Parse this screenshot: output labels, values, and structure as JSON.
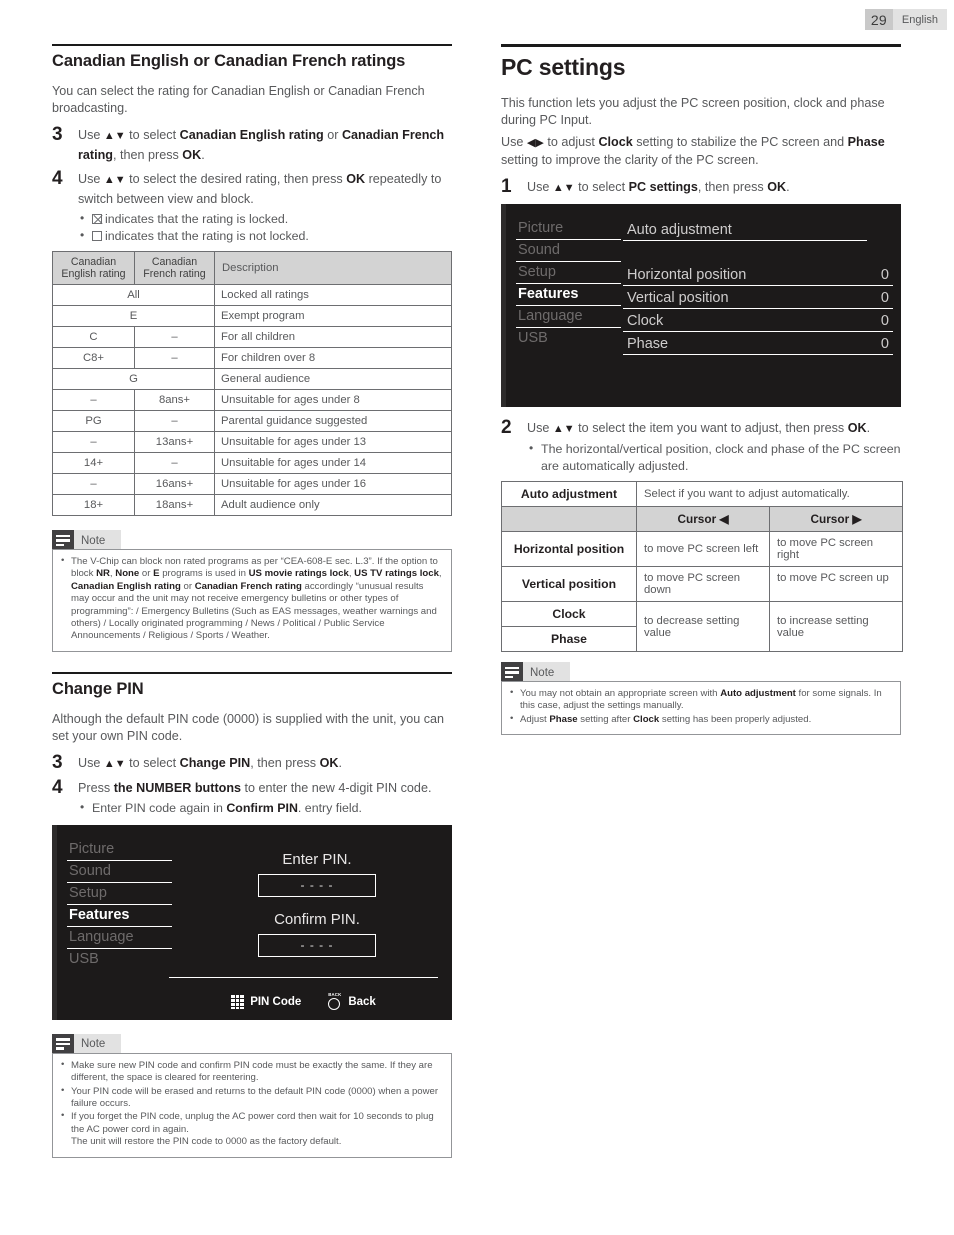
{
  "header": {
    "page_number": "29",
    "language": "English"
  },
  "left": {
    "section1_title": "Canadian English or Canadian French ratings",
    "intro": "You can select the rating for Canadian English or Canadian French broadcasting.",
    "step3_num": "3",
    "step4_num": "4",
    "bullet_locked": "indicates that the rating is locked.",
    "bullet_unlocked": "indicates that the rating is not locked.",
    "ratings_table": {
      "headers": [
        "Canadian English rating",
        "Canadian French rating",
        "Description"
      ],
      "rows": [
        {
          "span": true,
          "eng": "All",
          "fre": "",
          "desc": "Locked all ratings"
        },
        {
          "span": true,
          "eng": "E",
          "fre": "",
          "desc": "Exempt program"
        },
        {
          "span": false,
          "eng": "C",
          "fre": "–",
          "desc": "For all children"
        },
        {
          "span": false,
          "eng": "C8+",
          "fre": "–",
          "desc": "For children over 8"
        },
        {
          "span": true,
          "eng": "G",
          "fre": "",
          "desc": "General audience"
        },
        {
          "span": false,
          "eng": "–",
          "fre": "8ans+",
          "desc": "Unsuitable for ages under 8"
        },
        {
          "span": false,
          "eng": "PG",
          "fre": "–",
          "desc": "Parental guidance suggested"
        },
        {
          "span": false,
          "eng": "–",
          "fre": "13ans+",
          "desc": "Unsuitable for ages under 13"
        },
        {
          "span": false,
          "eng": "14+",
          "fre": "–",
          "desc": "Unsuitable for ages under 14"
        },
        {
          "span": false,
          "eng": "–",
          "fre": "16ans+",
          "desc": "Unsuitable for ages under 16"
        },
        {
          "span": false,
          "eng": "18+",
          "fre": "18ans+",
          "desc": "Adult audience only"
        }
      ]
    },
    "note1_label": "Note",
    "section2_title": "Change PIN",
    "change_pin_intro": "Although the default PIN code (0000) is supplied with the unit, you can set your own PIN code.",
    "pin_step3_num": "3",
    "pin_step4_num": "4",
    "pin_bullet": "Enter PIN code again in",
    "pin_screen": {
      "menu": [
        "Picture",
        "Sound",
        "Setup",
        "Features",
        "Language",
        "USB"
      ],
      "selected": "Features",
      "enter_label": "Enter PIN.",
      "confirm_label": "Confirm PIN.",
      "digits": "-      -      -      -",
      "foot_pin": "PIN Code",
      "foot_back": "Back",
      "back_icon_text": "BACK"
    },
    "note2_label": "Note"
  },
  "right": {
    "title": "PC settings",
    "intro1": "This function lets you adjust the PC screen position, clock and phase during PC Input.",
    "step1_num": "1",
    "step2_num": "2",
    "step2_bullet": "The horizontal/vertical position, clock and phase of the PC screen are automatically adjusted.",
    "pc_screen": {
      "menu": [
        "Picture",
        "Sound",
        "Setup",
        "Features",
        "Language",
        "USB"
      ],
      "selected": "Features",
      "items": [
        {
          "name": "Auto adjustment",
          "value": ""
        },
        {
          "name": "Horizontal position",
          "value": "0"
        },
        {
          "name": "Vertical position",
          "value": "0"
        },
        {
          "name": "Clock",
          "value": "0"
        },
        {
          "name": "Phase",
          "value": "0"
        }
      ]
    },
    "cursor_table": {
      "auto_label": "Auto adjustment",
      "auto_desc": "Select if you want to adjust automatically.",
      "cursor_left_hd": "Cursor ◀",
      "cursor_right_hd": "Cursor ▶",
      "rows": [
        {
          "label": "Horizontal position",
          "left": "to move PC screen left",
          "right": "to move PC screen right"
        },
        {
          "label": "Vertical position",
          "left": "to move PC screen down",
          "right": "to move PC screen up"
        },
        {
          "label": "Clock",
          "left": "to decrease setting value",
          "right": "to increase setting value"
        },
        {
          "label": "Phase",
          "left": "",
          "right": ""
        }
      ]
    },
    "note_label": "Note"
  },
  "colors": {
    "dark_text": "#231f20",
    "body_text": "#58595b",
    "table_header": "#d3d3d3",
    "screen_bg": "#1c1a1a"
  }
}
